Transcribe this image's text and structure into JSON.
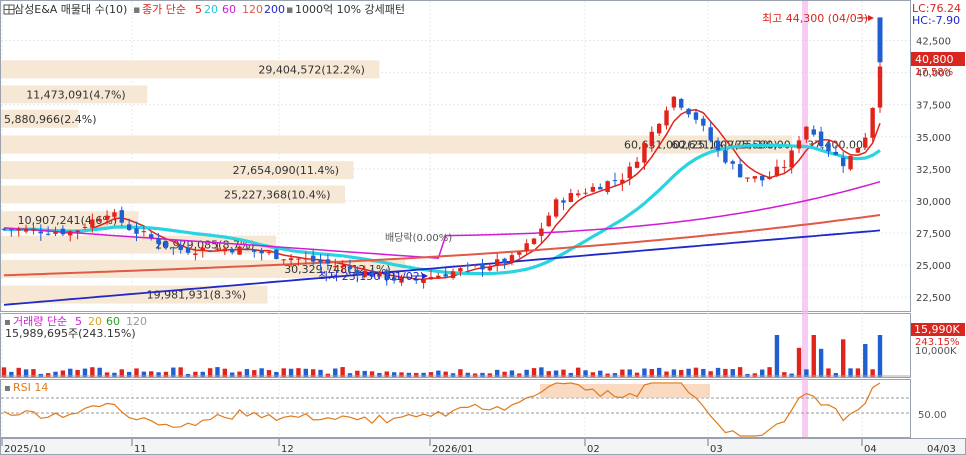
{
  "header": {
    "title": "삼성E&A 매물대 수(10)",
    "ma_label": "종가 단순",
    "ma_periods": [
      "5",
      "20",
      "60",
      "120",
      "200"
    ],
    "extra_label": "1000억 10% 강세패턴"
  },
  "volume_header": {
    "label": "거래량 단순",
    "periods": [
      "5",
      "20",
      "60",
      "120"
    ],
    "value_text": "15,989,695주(243.15%)"
  },
  "rsi_header": {
    "label": "RSI 14"
  },
  "right_badges": {
    "lc": "LC:76.24",
    "hc": "HC:-7.90",
    "price": "40,800",
    "pct": "17.58%",
    "vol": "15,990K",
    "vol_pct": "243.15%",
    "vol_tick": "10,000K",
    "rsi_tick": "50.00"
  },
  "annotations": {
    "high": "최고 44,300 (04/03)",
    "low": "최저 23,150 (01/02)",
    "band_text": "60,631,002(25.1%)(35,580.00 ~ 37,400.00)",
    "band_small": "배당락(0.00%)"
  },
  "volume_profile": [
    {
      "text": "29,404,572(12.2%)",
      "price": 40250,
      "len": 0.44
    },
    {
      "text": "11,473,091(4.7%)",
      "price": 38300,
      "len": 0.17
    },
    {
      "text": "5,880,966(2.4%)",
      "price": 36400,
      "len": 0.09
    },
    {
      "text": "60,631,002(25.1%)",
      "price": 34400,
      "len": 0.92
    },
    {
      "text": "27,654,090(11.4%)",
      "price": 32400,
      "len": 0.41
    },
    {
      "text": "25,227,368(10.4%)",
      "price": 30500,
      "len": 0.4
    },
    {
      "text": "10,907,241(4.6%)",
      "price": 28500,
      "len": 0.16
    },
    {
      "text": "20,979,085(8.7%)",
      "price": 26600,
      "len": 0.32
    },
    {
      "text": "30,329,748(12.1%)",
      "price": 24700,
      "len": 0.47
    },
    {
      "text": "19,981,931(8.3%)",
      "price": 22700,
      "len": 0.31
    }
  ],
  "chart_data": {
    "type": "candlestick",
    "y_axis": {
      "min": 21500,
      "max": 45500,
      "ticks": [
        "42,500",
        "40,000",
        "37,500",
        "35,000",
        "32,500",
        "30,000",
        "27,500",
        "25,000",
        "22,500"
      ]
    },
    "x_ticks": [
      "2025/10",
      "11",
      "12",
      "2026/01",
      "02",
      "03",
      "04",
      "04/03"
    ],
    "ma_colors": {
      "ma5": "#e0241b",
      "ma20": "#2ad3e0",
      "ma60": "#d21ad9",
      "ma120": "#e05a45",
      "ma200": "#1f28c8"
    },
    "candle_count": 120
  }
}
